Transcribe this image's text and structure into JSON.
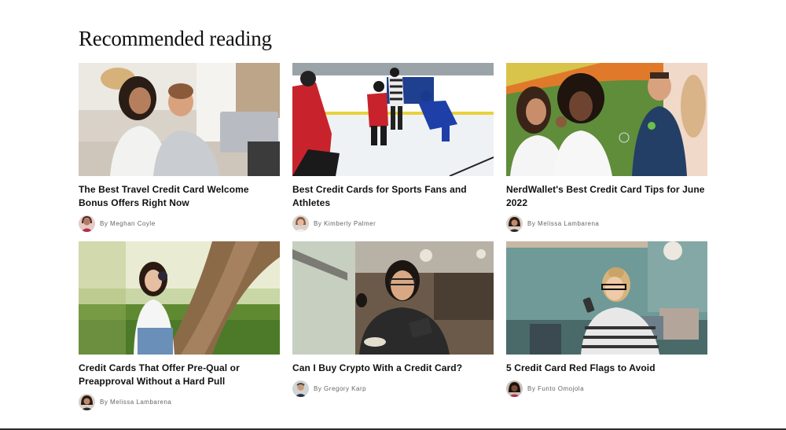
{
  "section": {
    "title": "Recommended reading"
  },
  "articles": [
    {
      "title": "The Best Travel Credit Card Welcome Bonus Offers Right Now",
      "byline": "By Meghan Coyle",
      "image": "couple-laptop-photo",
      "avatar": "author-photo"
    },
    {
      "title": "Best Credit Cards for Sports Fans and Athletes",
      "byline": "By Kimberly Palmer",
      "image": "hockey-game-photo",
      "avatar": "author-photo"
    },
    {
      "title": "NerdWallet's Best Credit Card Tips for June 2022",
      "byline": "By Melissa Lambarena",
      "image": "friends-bubbles-photo",
      "avatar": "author-photo"
    },
    {
      "title": "Credit Cards That Offer Pre-Qual or Preapproval Without a Hard Pull",
      "byline": "By Melissa Lambarena",
      "image": "woman-under-tree-photo",
      "avatar": "author-photo"
    },
    {
      "title": "Can I Buy Crypto With a Credit Card?",
      "byline": "By Gregory Karp",
      "image": "man-cafe-phone-photo",
      "avatar": "author-photo"
    },
    {
      "title": "5 Credit Card Red Flags to Avoid",
      "byline": "By Funto Omojola",
      "image": "woman-phone-cafe-photo",
      "avatar": "author-photo"
    }
  ],
  "colors": {
    "heading": "#111111",
    "byline": "#666666",
    "bottom_rule": "#2b2b2b"
  }
}
